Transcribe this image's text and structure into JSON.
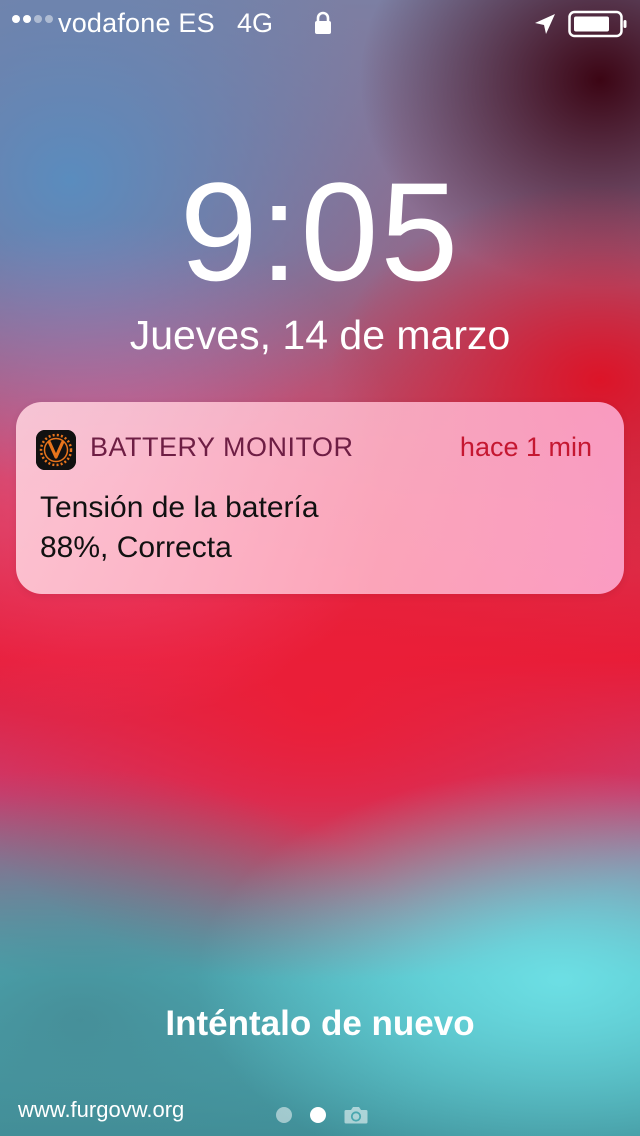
{
  "status_bar": {
    "carrier": "vodafone ES",
    "network": "4G",
    "signal_bars_total": 4,
    "signal_bars_filled": 2,
    "icons": [
      "signal-icon",
      "lock-icon",
      "location-icon",
      "battery-icon"
    ]
  },
  "lock_screen": {
    "time": "9:05",
    "date": "Jueves, 14 de marzo",
    "retry_text": "Inténtalo de nuevo"
  },
  "notification": {
    "app_name": "BATTERY MONITOR",
    "time_ago": "hace 1 min",
    "body_line1": "Tensión de la batería",
    "body_line2": "88%, Correcta",
    "icon": "app-logo-icon"
  },
  "page_indicator": {
    "pages": 2,
    "current": 2,
    "camera_icon": "camera-icon"
  },
  "watermark": "www.furgovw.org",
  "colors": {
    "app_name": "#6e1e44",
    "time_ago": "#c51731",
    "notification_bg": "#ffc3d6"
  }
}
